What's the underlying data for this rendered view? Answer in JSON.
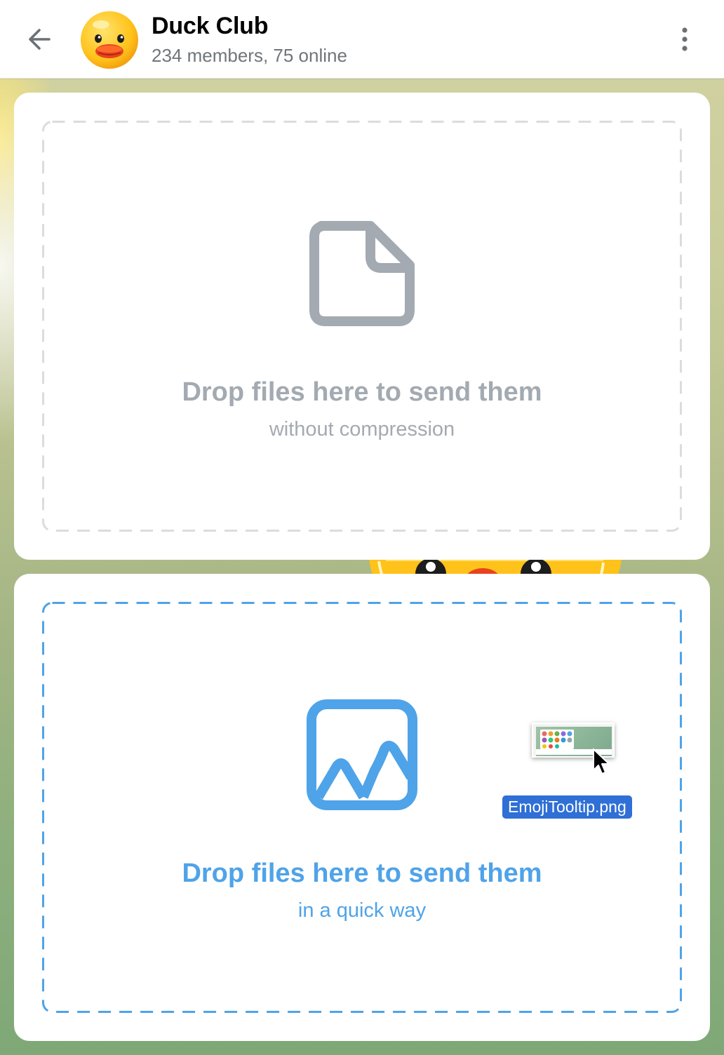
{
  "header": {
    "back_icon": "arrow-left-icon",
    "title": "Duck Club",
    "subtitle": "234 members, 75 online",
    "more_icon": "more-vertical-icon"
  },
  "drop_zones": [
    {
      "icon": "document-icon",
      "title": "Drop files here to send them",
      "subtitle": "without compression",
      "color": "#a3aab1",
      "state": "inactive"
    },
    {
      "icon": "image-icon",
      "title": "Drop files here to send them",
      "subtitle": "in a quick way",
      "color": "#4fa3e8",
      "state": "hover"
    }
  ],
  "drag": {
    "file_name": "EmojiTooltip.png"
  },
  "colors": {
    "accent": "#4fa3e8",
    "muted": "#a3aab1",
    "file_label_bg": "#2f6fd6"
  }
}
